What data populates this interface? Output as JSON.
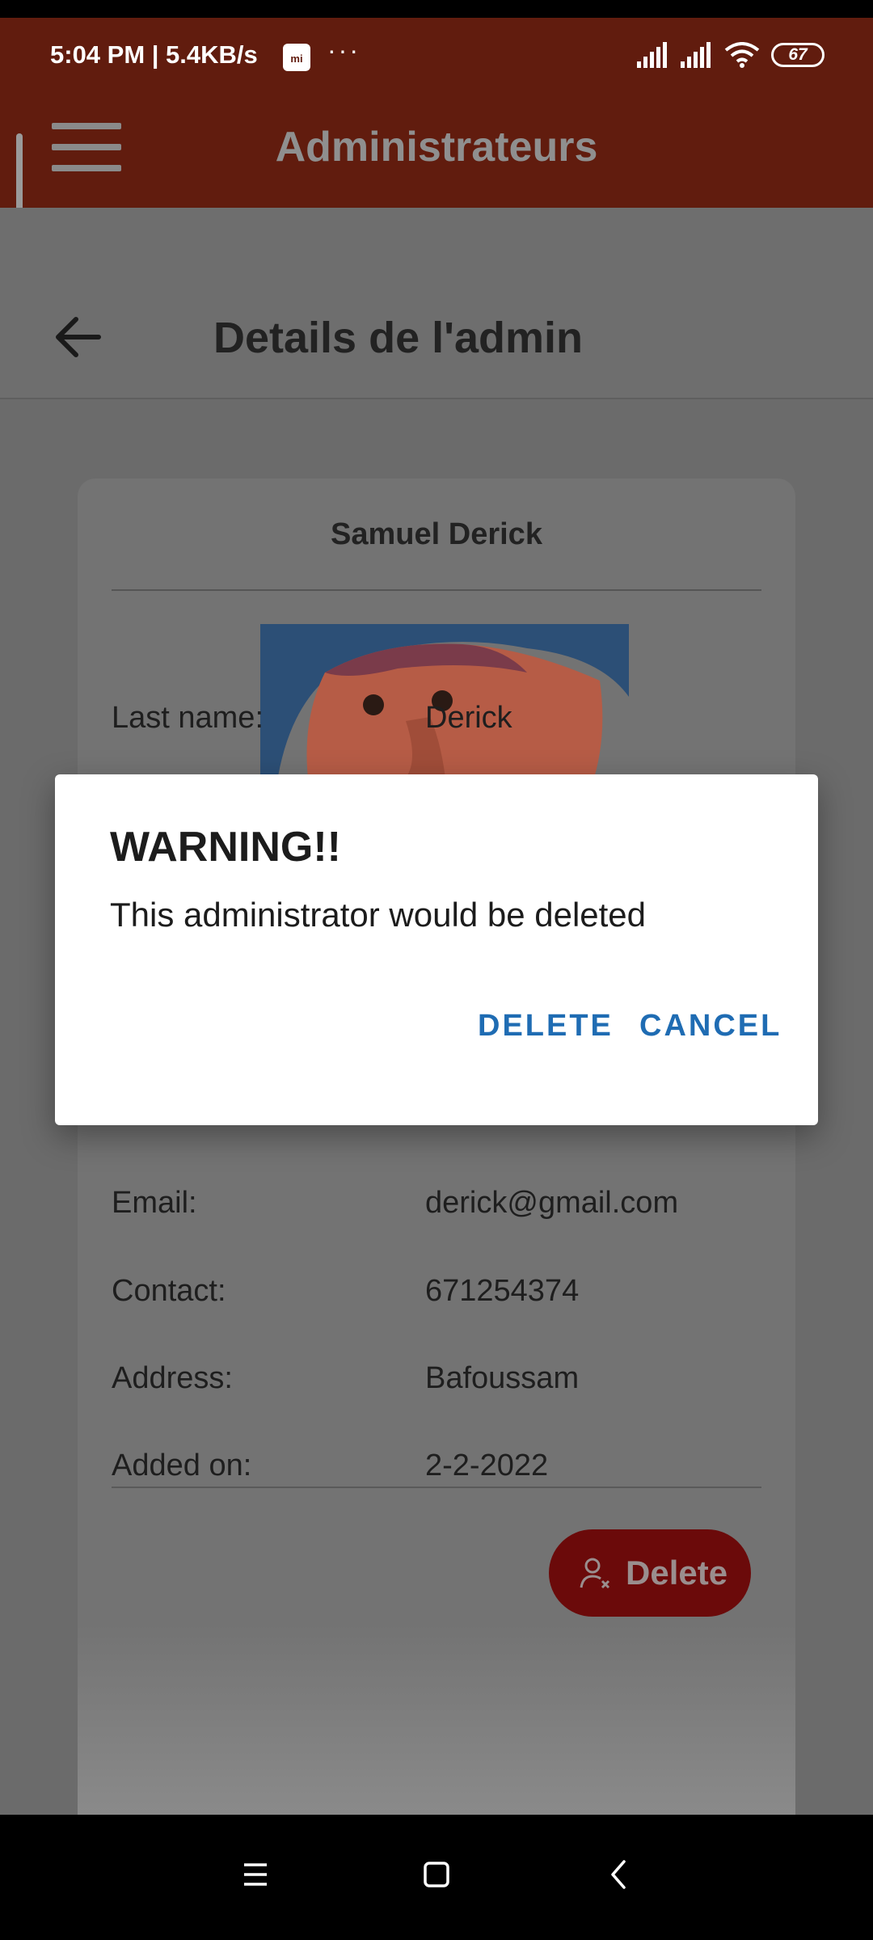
{
  "status_bar": {
    "time": "5:04 PM | 5.4KB/s",
    "mi_badge": "mi",
    "overflow": "···",
    "battery": "67"
  },
  "app_bar": {
    "title": "Administrateurs",
    "menu_icon": "hamburger-menu-icon"
  },
  "sub_header": {
    "title": "Details de l'admin",
    "back_icon": "arrow-left-icon"
  },
  "card": {
    "name": "Samuel Derick",
    "rows": [
      {
        "label": "Last name:",
        "value": "Derick"
      },
      {
        "label": "Email:",
        "value": "derick@gmail.com"
      },
      {
        "label": "Contact:",
        "value": "671254374"
      },
      {
        "label": "Address:",
        "value": "Bafoussam"
      },
      {
        "label": "Added on:",
        "value": "2-2-2022"
      }
    ],
    "delete_button": "Delete",
    "delete_icon": "remove-user-icon"
  },
  "dialog": {
    "title": "WARNING!!",
    "message": "This administrator would be deleted",
    "confirm": "DELETE",
    "cancel": "CANCEL"
  },
  "nav_bar": {
    "recent_icon": "recent-apps-icon",
    "home_icon": "home-icon",
    "back_icon": "back-icon"
  },
  "colors": {
    "app_bar": "#611c0e",
    "dialog_button": "#1f6cb3",
    "delete_button": "#6b0a0a"
  }
}
